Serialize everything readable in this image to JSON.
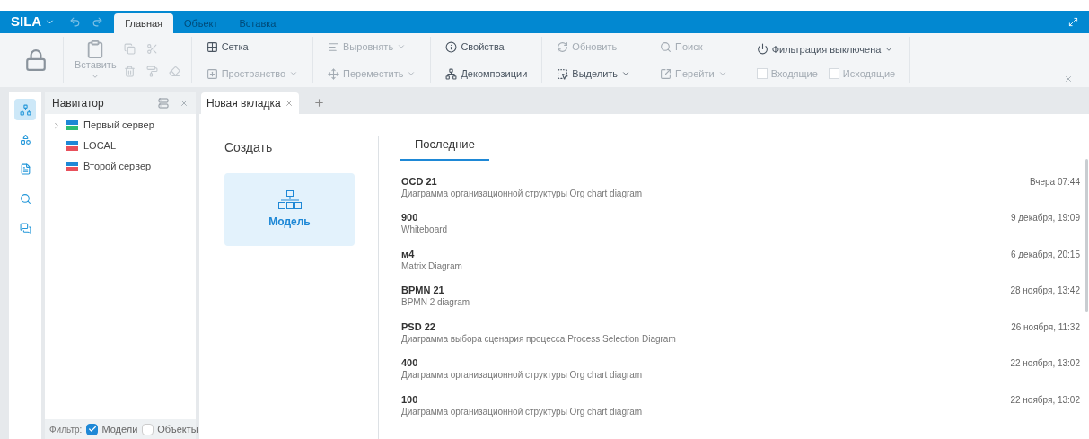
{
  "app": {
    "logo": "SILA",
    "tabs": [
      {
        "label": "Главная",
        "selected": true
      },
      {
        "label": "Объект",
        "selected": false
      },
      {
        "label": "Вставка",
        "selected": false
      }
    ]
  },
  "ribbon": {
    "groups": [
      {
        "kind": "big"
      },
      {
        "kind": "paste",
        "items": [
          {
            "label": "Вставить",
            "disabled": true,
            "dropdown": true
          }
        ]
      },
      {
        "kind": "stack",
        "items": [
          {
            "label": "Сетка",
            "disabled": false,
            "dropdown": false
          },
          {
            "label": "Пространство",
            "disabled": true,
            "dropdown": true
          }
        ]
      },
      {
        "kind": "stack",
        "items": [
          {
            "label": "Выровнять",
            "disabled": true,
            "dropdown": true
          },
          {
            "label": "Переместить",
            "disabled": true,
            "dropdown": true
          }
        ]
      },
      {
        "kind": "stack",
        "items": [
          {
            "label": "Свойства",
            "disabled": false,
            "dropdown": false
          },
          {
            "label": "Декомпозиции",
            "disabled": false,
            "dropdown": false
          }
        ]
      },
      {
        "kind": "stack",
        "items": [
          {
            "label": "Обновить",
            "disabled": true,
            "dropdown": false
          },
          {
            "label": "Выделить",
            "disabled": false,
            "dropdown": true
          }
        ]
      },
      {
        "kind": "stack",
        "items": [
          {
            "label": "Поиск",
            "disabled": true,
            "dropdown": false
          },
          {
            "label": "Перейти",
            "disabled": true,
            "dropdown": true
          }
        ]
      },
      {
        "kind": "filter",
        "items": [
          {
            "label": "Фильтрация выключена",
            "disabled": false,
            "dropdown": true
          }
        ],
        "checks": [
          {
            "label": "Входящие",
            "checked": false,
            "disabled": true
          },
          {
            "label": "Исходящие",
            "checked": false,
            "disabled": true
          }
        ]
      }
    ]
  },
  "sidebar": {
    "items": [
      {
        "selected": true
      },
      {
        "selected": false
      },
      {
        "selected": false
      },
      {
        "selected": false
      },
      {
        "selected": false
      }
    ]
  },
  "navigator": {
    "title": "Навигатор",
    "items": [
      {
        "label": "Первый сервер",
        "expanded": false,
        "color": "#2ebd73"
      },
      {
        "label": "LOCAL",
        "color": "#e8505b"
      },
      {
        "label": "Второй сервер",
        "color": "#e8505b"
      }
    ],
    "filter": {
      "label": "Фильтр:",
      "options": [
        {
          "label": "Модели",
          "checked": true
        },
        {
          "label": "Объекты",
          "checked": false
        }
      ]
    }
  },
  "doc_tabs": [
    {
      "label": "Новая вкладка",
      "selected": true
    }
  ],
  "create": {
    "title": "Создать",
    "tiles": [
      {
        "label": "Модель"
      }
    ]
  },
  "recent": {
    "tabs": [
      {
        "label": "Последние",
        "selected": true
      }
    ],
    "items": [
      {
        "title": "OCD 21",
        "description": "Диаграмма организационной структуры Org chart diagram",
        "date": "Вчера 07:44"
      },
      {
        "title": "900",
        "description": "Whiteboard",
        "date": "9 декабря, 19:09"
      },
      {
        "title": "м4",
        "description": "Matrix Diagram",
        "date": "6 декабря, 20:15"
      },
      {
        "title": "BPMN 21",
        "description": "BPMN 2 diagram",
        "date": "28 ноября, 13:42"
      },
      {
        "title": "PSD 22",
        "description": "Диаграмма выбора сценария процесса Process Selection Diagram",
        "date": "26 ноября, 11:32"
      },
      {
        "title": "400",
        "description": "Диаграмма организационной структуры Org chart diagram",
        "date": "22 ноября, 13:02"
      },
      {
        "title": "100",
        "description": "Диаграмма организационной структуры Org chart diagram",
        "date": "22 ноября, 13:02"
      }
    ]
  }
}
